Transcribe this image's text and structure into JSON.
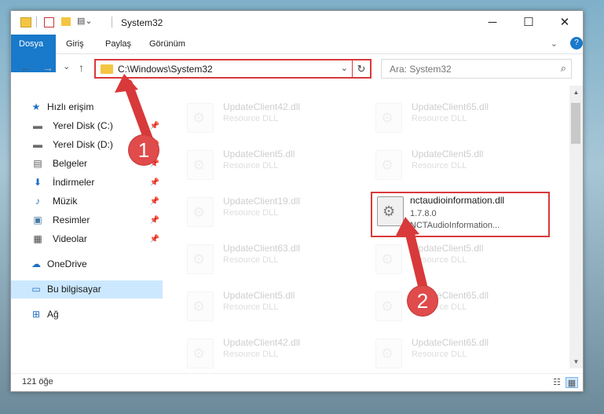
{
  "window": {
    "title": "System32",
    "controls": {
      "minimize": "─",
      "maximize": "☐",
      "close": "✕"
    }
  },
  "ribbon": {
    "tabs": [
      "Dosya",
      "Giriş",
      "Paylaş",
      "Görünüm"
    ],
    "collapse": "⌄",
    "help": "?"
  },
  "navigation": {
    "back": "←",
    "forward": "→",
    "recent": "⌄",
    "up": "↑",
    "address": "C:\\Windows\\System32",
    "address_dropdown": "⌄",
    "refresh": "↻",
    "search_placeholder": "Ara: System32",
    "search_icon": "⌕"
  },
  "sidebar": {
    "items": [
      {
        "label": "Hızlı erişim",
        "icon": "star-icon",
        "glyph": "★",
        "color": "#1f6fc5"
      },
      {
        "label": "Yerel Disk (C:)",
        "icon": "drive-icon",
        "glyph": "▬",
        "pin": "📌",
        "color": "#6b6b6b"
      },
      {
        "label": "Yerel Disk (D:)",
        "icon": "drive-icon",
        "glyph": "▬",
        "pin": "📌",
        "color": "#6b6b6b"
      },
      {
        "label": "Belgeler",
        "icon": "documents-icon",
        "glyph": "▤",
        "pin": "📌",
        "color": "#5b5b5b"
      },
      {
        "label": "İndirmeler",
        "icon": "downloads-icon",
        "glyph": "⬇",
        "pin": "📌",
        "color": "#1f6fc5"
      },
      {
        "label": "Müzik",
        "icon": "music-icon",
        "glyph": "♪",
        "pin": "📌",
        "color": "#1f6fc5"
      },
      {
        "label": "Resimler",
        "icon": "pictures-icon",
        "glyph": "▣",
        "pin": "📌",
        "color": "#4a7ba6"
      },
      {
        "label": "Videolar",
        "icon": "videos-icon",
        "glyph": "▦",
        "pin": "📌",
        "color": "#444"
      },
      {
        "label": "OneDrive",
        "icon": "cloud-icon",
        "glyph": "☁",
        "color": "#1f6fc5"
      },
      {
        "label": "Bu bilgisayar",
        "icon": "computer-icon",
        "glyph": "▭",
        "color": "#1f6fc5",
        "selected": true
      },
      {
        "label": "Ağ",
        "icon": "network-icon",
        "glyph": "⊞",
        "color": "#1f6fc5"
      }
    ]
  },
  "files": {
    "left_column": [
      {
        "name": "UpdateClient42.dll",
        "type": "Resource DLL"
      },
      {
        "name": "UpdateClient5.dll",
        "type": "Resource DLL"
      },
      {
        "name": "UpdateClient19.dll",
        "type": "Resource DLL"
      },
      {
        "name": "UpdateClient63.dll",
        "type": "Resource DLL"
      },
      {
        "name": "UpdateClient5.dll",
        "type": "Resource DLL"
      },
      {
        "name": "UpdateClient42.dll",
        "type": "Resource DLL"
      }
    ],
    "right_column": [
      {
        "name": "UpdateClient65.dll",
        "type": "Resource DLL"
      },
      {
        "name": "UpdateClient5.dll",
        "type": "Resource DLL"
      },
      {
        "name": "UpdateClient5.dll",
        "type": "Resource DLL"
      },
      {
        "name": "UpdateClient65.dll",
        "type": "Resource DLL"
      },
      {
        "name": "UpdateClient65.dll",
        "type": "Resource DLL"
      }
    ],
    "highlighted": {
      "name": "nctaudioinformation.dll",
      "version": "1.7.8.0",
      "description": "NCTAudioInformation..."
    }
  },
  "status": {
    "item_count": "121 öğe",
    "view_details": "☷",
    "view_icons": "▦"
  },
  "annotations": {
    "badge1": "1",
    "badge2": "2",
    "color": "#d8393a"
  }
}
